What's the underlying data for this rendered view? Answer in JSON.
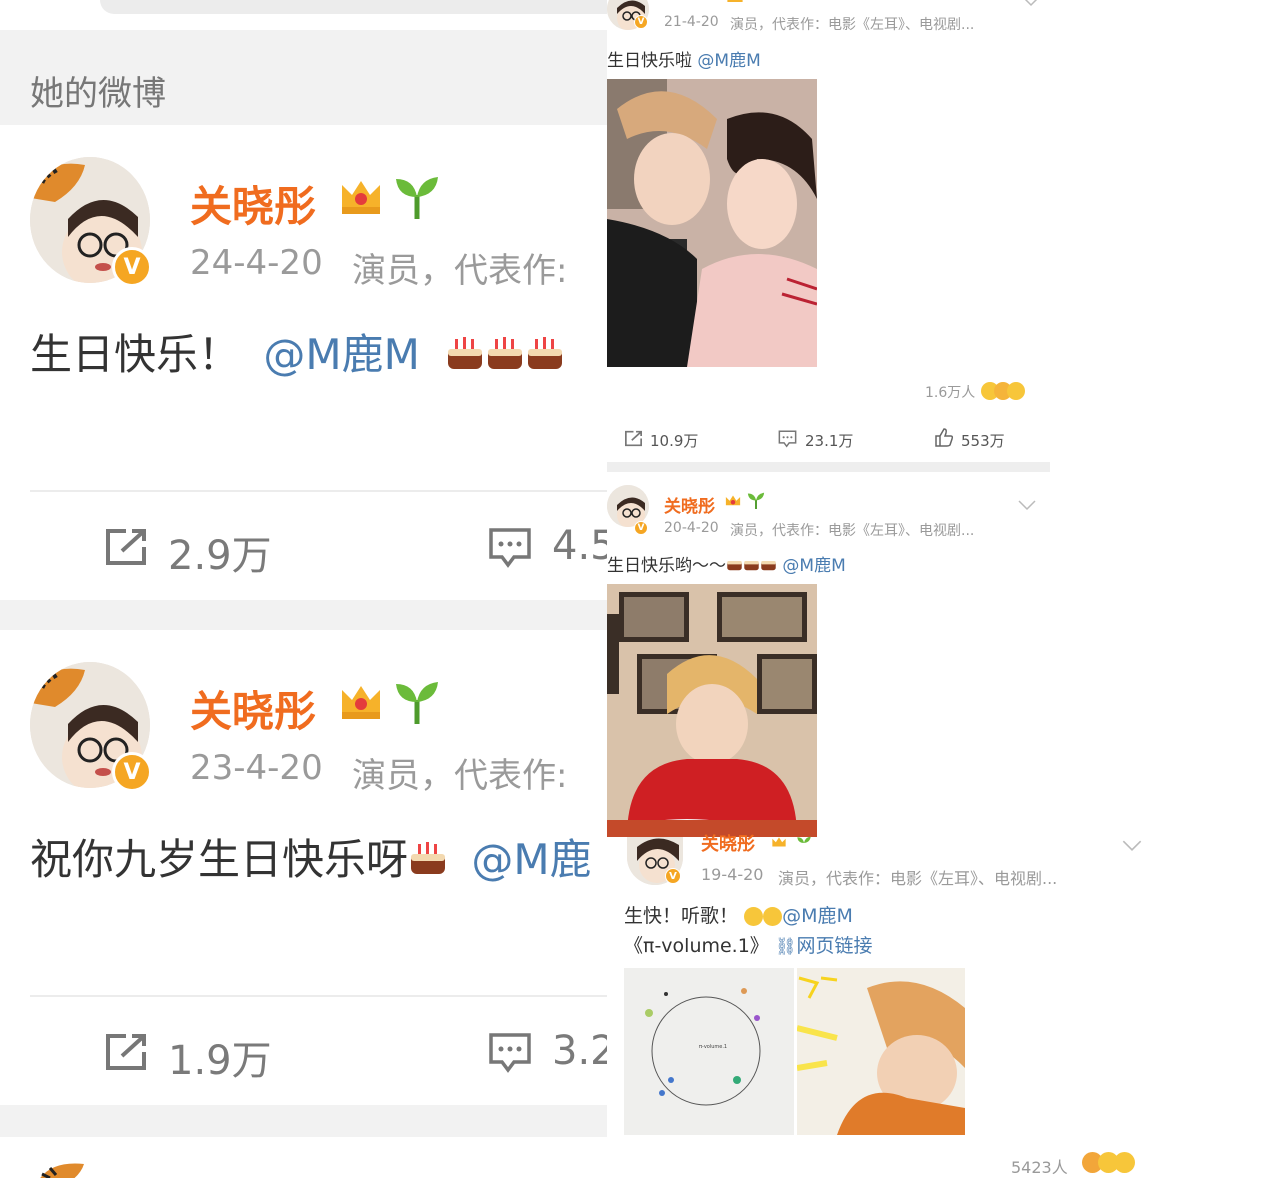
{
  "left": {
    "section_title": "她的微博",
    "posts": [
      {
        "name": "关晓彤",
        "date": "24-4-20",
        "desc": "演员，代表作:",
        "text": "生日快乐！",
        "mention": "@M鹿M",
        "repost": "2.9万",
        "comment": "4.5"
      },
      {
        "name": "关晓彤",
        "date": "23-4-20",
        "desc": "演员，代表作:",
        "text": "祝你九岁生日快乐呀",
        "mention": "@M鹿",
        "repost": "1.9万",
        "comment": "3.2"
      }
    ]
  },
  "right": {
    "post1": {
      "date": "21-4-20",
      "desc": "演员，代表作：电影《左耳》、电视剧...",
      "text": "生日快乐啦",
      "mention": "@M鹿M",
      "reactions": "1.6万人",
      "repost": "10.9万",
      "comment": "23.1万",
      "like": "553万"
    },
    "post2": {
      "name": "关晓彤",
      "date": "20-4-20",
      "desc": "演员，代表作：电影《左耳》、电视剧...",
      "text": "生日快乐哟～～",
      "mention": "@M鹿M"
    },
    "post3": {
      "name": "关晓彤",
      "date": "19-4-20",
      "desc": "演员，代表作：电影《左耳》、电视剧...",
      "text": "生快！听歌！",
      "mention": "@M鹿M",
      "line2": "《π-volume.1》",
      "link": "网页链接",
      "album_text": "π-volume.1",
      "reactions": "5423人"
    }
  },
  "icons": [
    "crown-icon",
    "sprout-icon",
    "verified-v-icon",
    "repost-icon",
    "comment-icon",
    "like-icon",
    "link-icon",
    "chevron-down-icon",
    "cake-emoji-icon",
    "face-emoji-icon"
  ],
  "colors": {
    "name": "#f06c1f",
    "mention": "#4a7cb0",
    "verified": "#f5a623",
    "meta": "#9a9a9a",
    "divider": "#f2f2f2"
  }
}
